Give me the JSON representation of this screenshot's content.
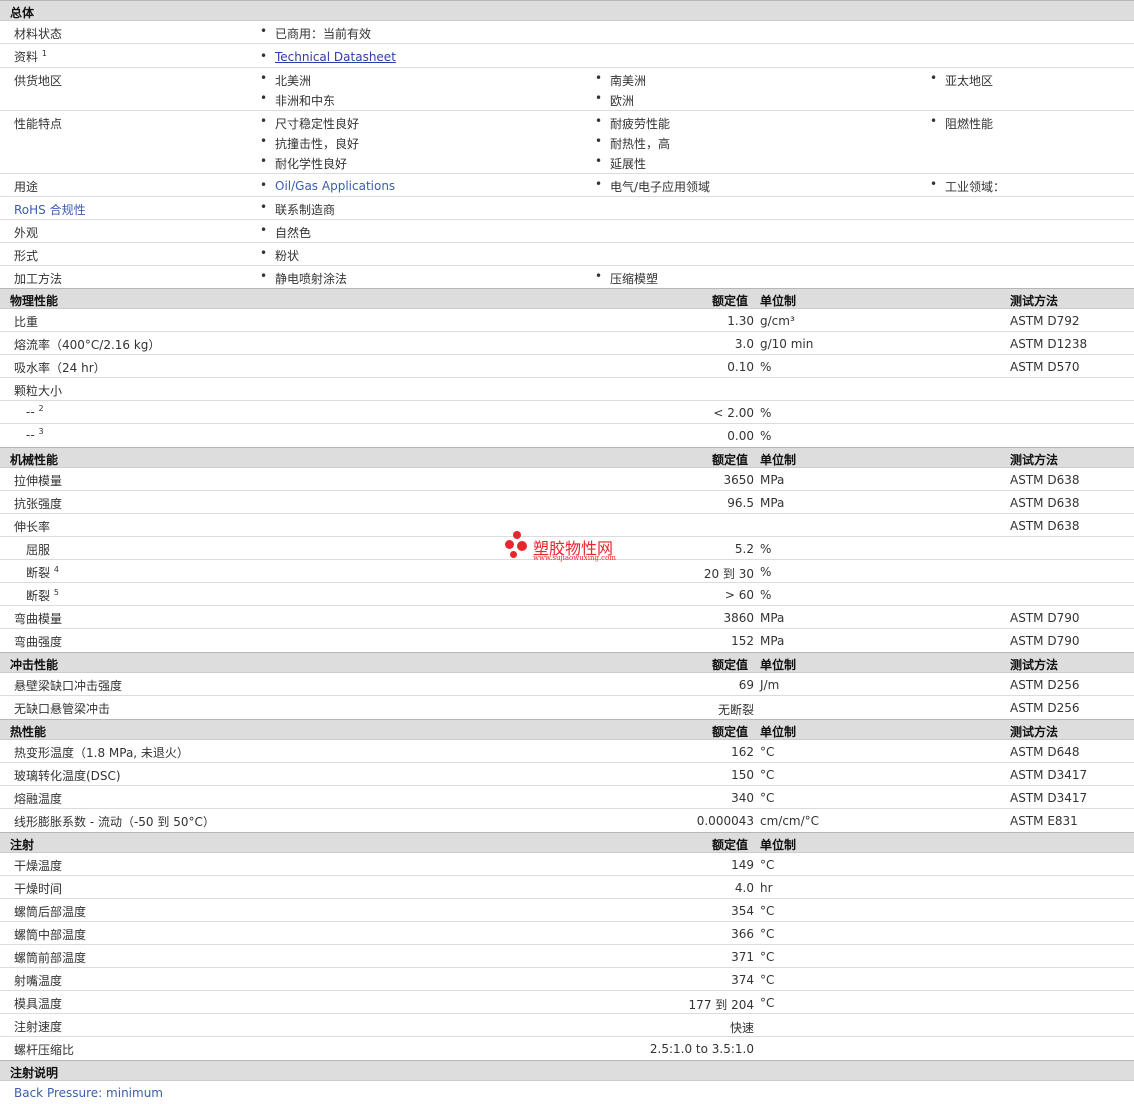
{
  "general": {
    "title": "总体",
    "status": {
      "label": "材料状态",
      "value": "已商用：当前有效"
    },
    "docs": {
      "label": "资料",
      "sup": "1",
      "link": "Technical Datasheet"
    },
    "supply": {
      "label": "供货地区",
      "c1": [
        "北美洲",
        "非洲和中东"
      ],
      "c2": [
        "南美洲",
        "欧洲"
      ],
      "c3": [
        "亚太地区"
      ]
    },
    "features": {
      "label": "性能特点",
      "c1": [
        "尺寸稳定性良好",
        "抗撞击性，良好",
        "耐化学性良好"
      ],
      "c2": [
        "耐疲劳性能",
        "耐热性，高",
        "延展性"
      ],
      "c3": [
        "阻燃性能"
      ]
    },
    "uses": {
      "label": "用途",
      "c1": "Oil/Gas Applications",
      "c2": "电气/电子应用领域",
      "c3": "工业领域："
    },
    "rohs": {
      "label": "RoHS 合规性",
      "value": "联系制造商"
    },
    "appearance": {
      "label": "外观",
      "value": "自然色"
    },
    "form": {
      "label": "形式",
      "value": "粉状"
    },
    "processing": {
      "label": "加工方法",
      "c1": "静电喷射涂法",
      "c2": "压缩模塑"
    }
  },
  "col_headers": {
    "value": "额定值",
    "unit": "单位制",
    "method": "测试方法"
  },
  "physical": {
    "title": "物理性能",
    "rows": [
      {
        "label": "比重",
        "value": "1.30",
        "unit": "g/cm³",
        "method": "ASTM D792"
      },
      {
        "label": "熔流率（400°C/2.16 kg）",
        "value": "3.0",
        "unit": "g/10 min",
        "method": "ASTM D1238"
      },
      {
        "label": "吸水率（24 hr）",
        "value": "0.10",
        "unit": "%",
        "method": "ASTM D570"
      },
      {
        "label": "颗粒大小",
        "value": "",
        "unit": "",
        "method": ""
      },
      {
        "label": "--",
        "sup": "2",
        "sub": true,
        "value": "< 2.00",
        "unit": "%",
        "method": ""
      },
      {
        "label": "--",
        "sup": "3",
        "sub": true,
        "value": "0.00",
        "unit": "%",
        "method": ""
      }
    ]
  },
  "mechanical": {
    "title": "机械性能",
    "rows": [
      {
        "label": "拉伸模量",
        "value": "3650",
        "unit": "MPa",
        "method": "ASTM D638"
      },
      {
        "label": "抗张强度",
        "value": "96.5",
        "unit": "MPa",
        "method": "ASTM D638"
      },
      {
        "label": "伸长率",
        "value": "",
        "unit": "",
        "method": "ASTM D638"
      },
      {
        "label": "屈服",
        "sub": true,
        "value": "5.2",
        "unit": "%",
        "method": ""
      },
      {
        "label": "断裂",
        "sup": "4",
        "sub": true,
        "value": "20 到  30",
        "unit": "%",
        "method": ""
      },
      {
        "label": "断裂",
        "sup": "5",
        "sub": true,
        "value": "> 60",
        "unit": "%",
        "method": ""
      },
      {
        "label": "弯曲模量",
        "value": "3860",
        "unit": "MPa",
        "method": "ASTM D790"
      },
      {
        "label": "弯曲强度",
        "value": "152",
        "unit": "MPa",
        "method": "ASTM D790"
      }
    ]
  },
  "impact": {
    "title": "冲击性能",
    "rows": [
      {
        "label": "悬壁梁缺口冲击强度",
        "value": "69",
        "unit": "J/m",
        "method": "ASTM D256"
      },
      {
        "label": "无缺口悬管梁冲击",
        "value": "无断裂",
        "unit": "",
        "method": "ASTM D256"
      }
    ]
  },
  "thermal": {
    "title": "热性能",
    "rows": [
      {
        "label": "热变形温度（1.8 MPa, 未退火）",
        "value": "162",
        "unit": "°C",
        "method": "ASTM D648"
      },
      {
        "label": "玻璃转化温度(DSC)",
        "value": "150",
        "unit": "°C",
        "method": "ASTM D3417"
      },
      {
        "label": "熔融温度",
        "value": "340",
        "unit": "°C",
        "method": "ASTM D3417"
      },
      {
        "label": "线形膨胀系数 - 流动（-50 到  50°C）",
        "value": "0.000043",
        "unit": "cm/cm/°C",
        "method": "ASTM E831"
      }
    ]
  },
  "injection": {
    "title": "注射",
    "rows": [
      {
        "label": "干燥温度",
        "value": "149",
        "unit": "°C"
      },
      {
        "label": "干燥时间",
        "value": "4.0",
        "unit": "hr"
      },
      {
        "label": "螺筒后部温度",
        "value": "354",
        "unit": "°C"
      },
      {
        "label": "螺筒中部温度",
        "value": "366",
        "unit": "°C"
      },
      {
        "label": "螺筒前部温度",
        "value": "371",
        "unit": "°C"
      },
      {
        "label": "射嘴温度",
        "value": "374",
        "unit": "°C"
      },
      {
        "label": "模具温度",
        "value": "177 到  204",
        "unit": "°C"
      },
      {
        "label": "注射速度",
        "value": "快速",
        "unit": ""
      },
      {
        "label": "螺杆压缩比",
        "value": "2.5:1.0 to 3.5:1.0",
        "unit": ""
      }
    ]
  },
  "notes": {
    "title": "注射说明",
    "text": "Back Pressure: minimum"
  },
  "watermark": {
    "text": "塑胶物性网",
    "url": "www.sujiaowuxing.com",
    "color": "#e8262d"
  }
}
